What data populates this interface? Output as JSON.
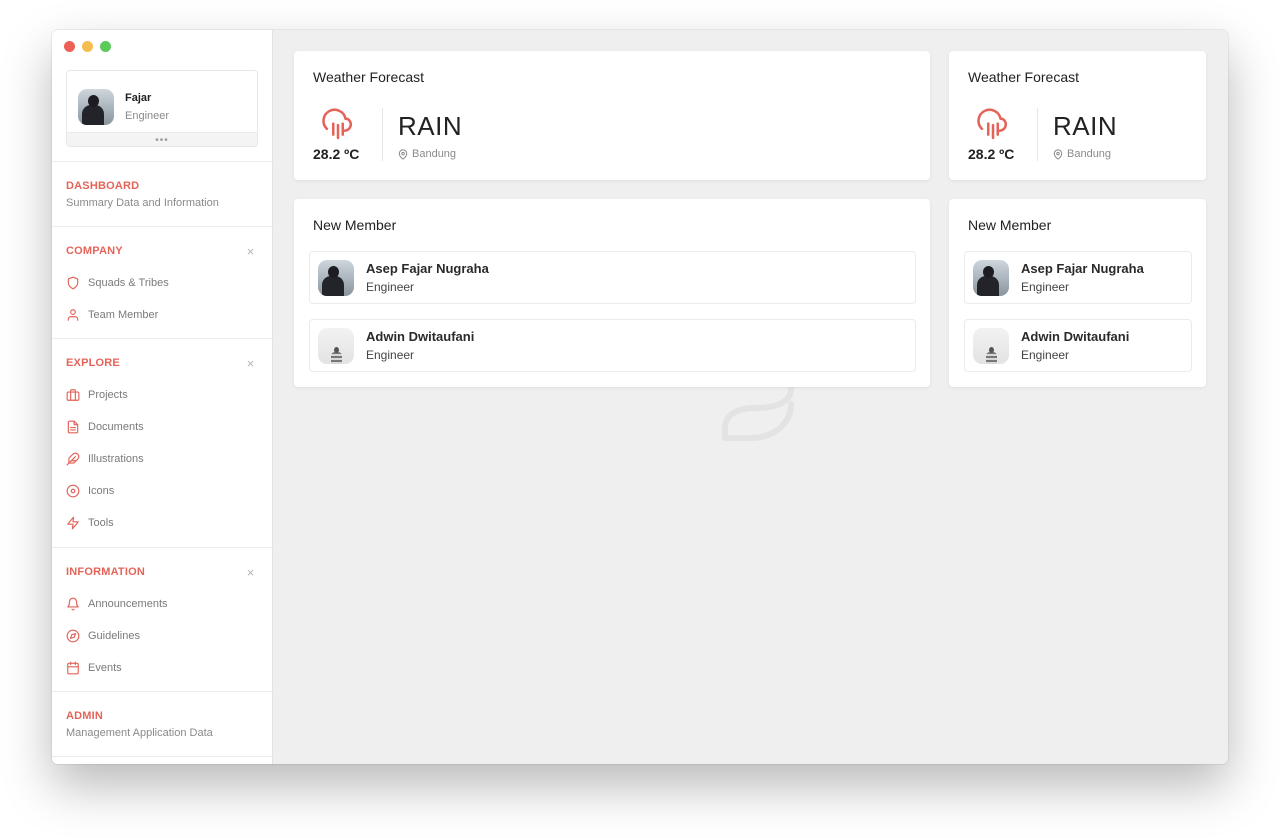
{
  "profile": {
    "name": "Fajar",
    "role": "Engineer",
    "more": "•••"
  },
  "sidebar": {
    "dashboard": {
      "title": "DASHBOARD",
      "subtitle": "Summary Data and Information"
    },
    "company": {
      "title": "COMPANY",
      "items": [
        {
          "label": "Squads & Tribes",
          "icon": "shield-icon"
        },
        {
          "label": "Team Member",
          "icon": "user-icon"
        }
      ]
    },
    "explore": {
      "title": "EXPLORE",
      "items": [
        {
          "label": "Projects",
          "icon": "briefcase-icon"
        },
        {
          "label": "Documents",
          "icon": "document-icon"
        },
        {
          "label": "Illustrations",
          "icon": "feather-icon"
        },
        {
          "label": "Icons",
          "icon": "disc-icon"
        },
        {
          "label": "Tools",
          "icon": "zap-icon"
        }
      ]
    },
    "information": {
      "title": "INFORMATION",
      "items": [
        {
          "label": "Announcements",
          "icon": "bell-icon"
        },
        {
          "label": "Guidelines",
          "icon": "compass-icon"
        },
        {
          "label": "Events",
          "icon": "calendar-icon"
        }
      ]
    },
    "admin": {
      "title": "ADMIN",
      "subtitle": "Management Application Data"
    },
    "close_glyph": "×"
  },
  "weather": [
    {
      "title": "Weather Forecast",
      "temperature": "28.2 ºC",
      "condition": "RAIN",
      "location": "Bandung",
      "icon": "cloud-rain-icon"
    },
    {
      "title": "Weather Forecast",
      "temperature": "28.2 ºC",
      "condition": "RAIN",
      "location": "Bandung",
      "icon": "cloud-rain-icon"
    }
  ],
  "members_panels": [
    {
      "title": "New Member",
      "members": [
        {
          "name": "Asep Fajar Nugraha",
          "role": "Engineer"
        },
        {
          "name": "Adwin Dwitaufani",
          "role": "Engineer"
        }
      ]
    },
    {
      "title": "New Member",
      "members": [
        {
          "name": "Asep Fajar Nugraha",
          "role": "Engineer"
        },
        {
          "name": "Adwin Dwitaufani",
          "role": "Engineer"
        }
      ]
    }
  ],
  "colors": {
    "accent": "#e4645a",
    "background": "#efefef",
    "sidebar": "#ffffff"
  }
}
